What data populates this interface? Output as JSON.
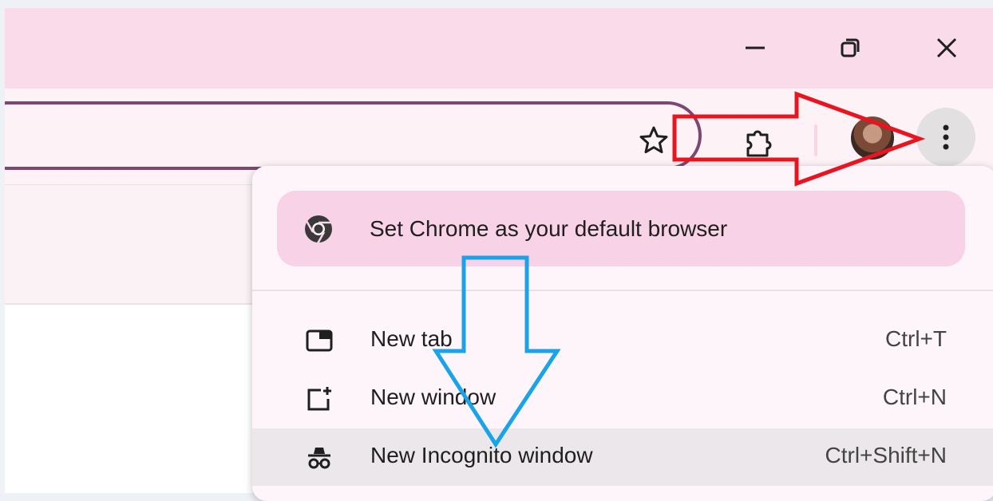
{
  "window_controls": {
    "minimize": "minimize-icon",
    "restore": "restore-icon",
    "close": "close-icon"
  },
  "toolbar": {
    "bookmark_icon": "star-icon",
    "extensions_icon": "puzzle-icon",
    "menu_icon": "three-dots-vertical-icon"
  },
  "menu": {
    "promo": {
      "label": "Set Chrome as your default browser",
      "icon": "chrome-logo-icon"
    },
    "items": [
      {
        "label": "New tab",
        "shortcut": "Ctrl+T",
        "icon": "new-tab-icon"
      },
      {
        "label": "New window",
        "shortcut": "Ctrl+N",
        "icon": "new-window-icon"
      },
      {
        "label": "New Incognito window",
        "shortcut": "Ctrl+Shift+N",
        "icon": "incognito-icon",
        "highlighted": true
      }
    ]
  },
  "annotations": {
    "red_arrow": "arrow-right-pointer",
    "blue_arrow": "arrow-down-pointer"
  },
  "colors": {
    "titlebar": "#fadbe9",
    "omnibox_border": "#7d4870",
    "promo_bg": "#f8d2e6",
    "red_arrow": "#e8141f",
    "blue_arrow": "#1aa3e8"
  }
}
